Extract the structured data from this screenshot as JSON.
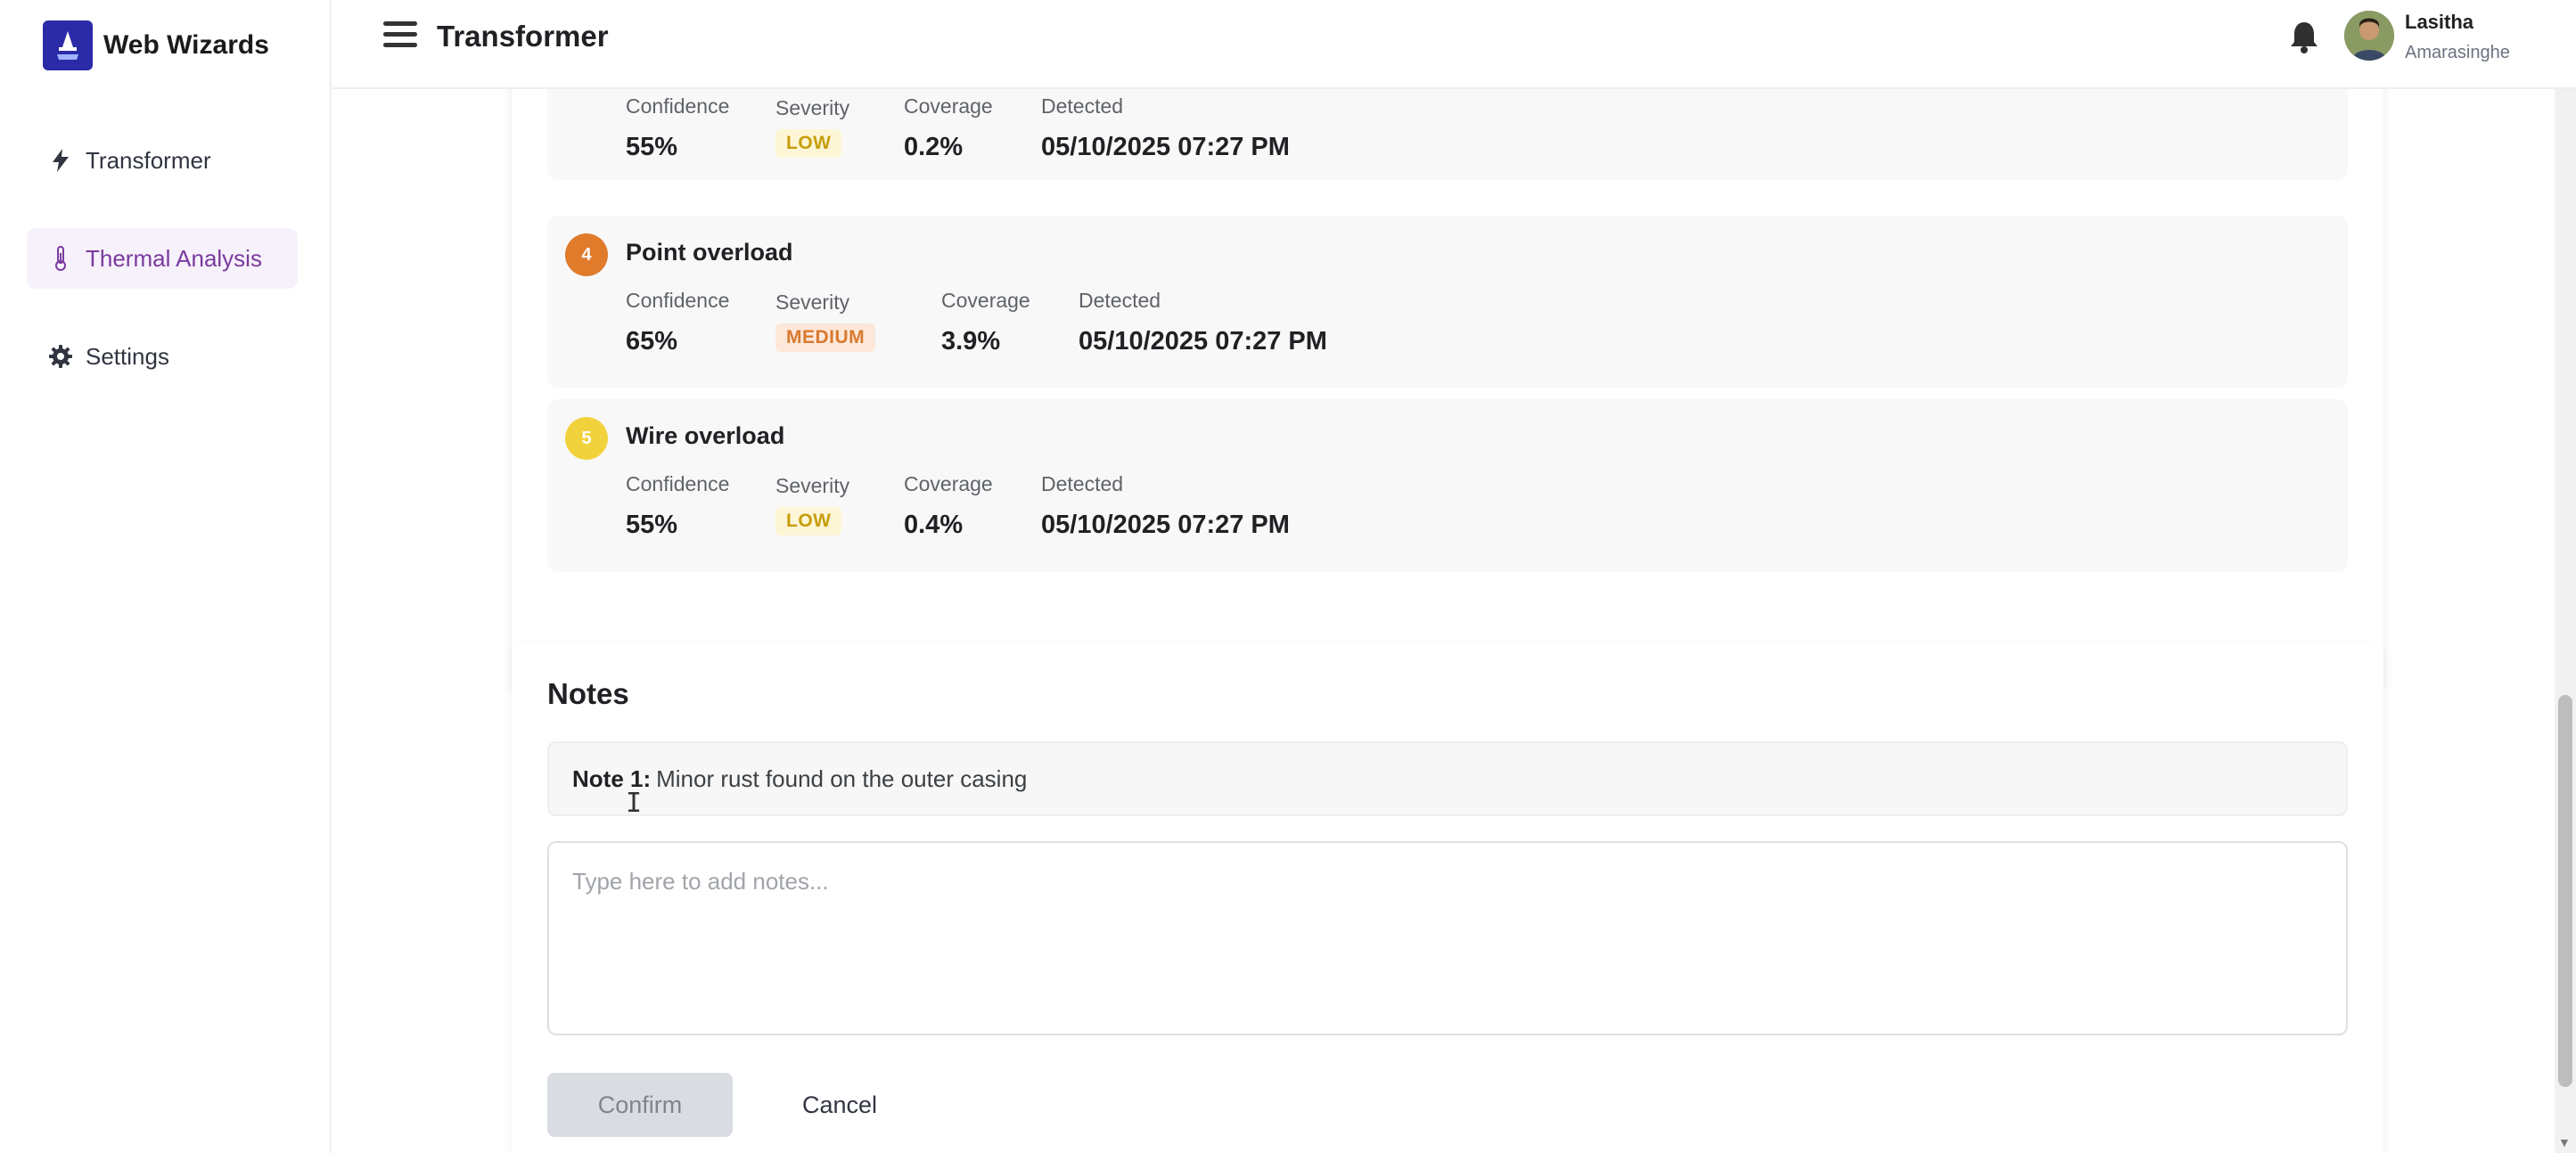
{
  "brand": {
    "name": "Web Wizards"
  },
  "sidebar": {
    "items": [
      {
        "label": "Transformer",
        "icon": "bolt-icon",
        "active": false
      },
      {
        "label": "Thermal Analysis",
        "icon": "thermometer-icon",
        "active": true
      },
      {
        "label": "Settings",
        "icon": "gear-icon",
        "active": false
      }
    ]
  },
  "header": {
    "title": "Transformer",
    "user": {
      "first_name": "Lasitha",
      "last_name": "Amarasinghe"
    }
  },
  "anomalies": {
    "labels": {
      "confidence": "Confidence",
      "severity": "Severity",
      "coverage": "Coverage",
      "detected": "Detected"
    },
    "items": [
      {
        "number": "",
        "title": "",
        "confidence": "55%",
        "severity": "LOW",
        "coverage": "0.2%",
        "detected": "05/10/2025 07:27 PM",
        "color": "#f5c518"
      },
      {
        "number": "4",
        "title": "Point overload",
        "confidence": "65%",
        "severity": "MEDIUM",
        "coverage": "3.9%",
        "detected": "05/10/2025 07:27 PM",
        "color": "#e07b2c"
      },
      {
        "number": "5",
        "title": "Wire overload",
        "confidence": "55%",
        "severity": "LOW",
        "coverage": "0.4%",
        "detected": "05/10/2025 07:27 PM",
        "color": "#f2d23c"
      }
    ]
  },
  "notes": {
    "title": "Notes",
    "existing": [
      {
        "label": "Note 1:",
        "text": "Minor rust found on the outer casing"
      }
    ],
    "input_placeholder": "Type here to add notes...",
    "confirm_label": "Confirm",
    "cancel_label": "Cancel"
  }
}
